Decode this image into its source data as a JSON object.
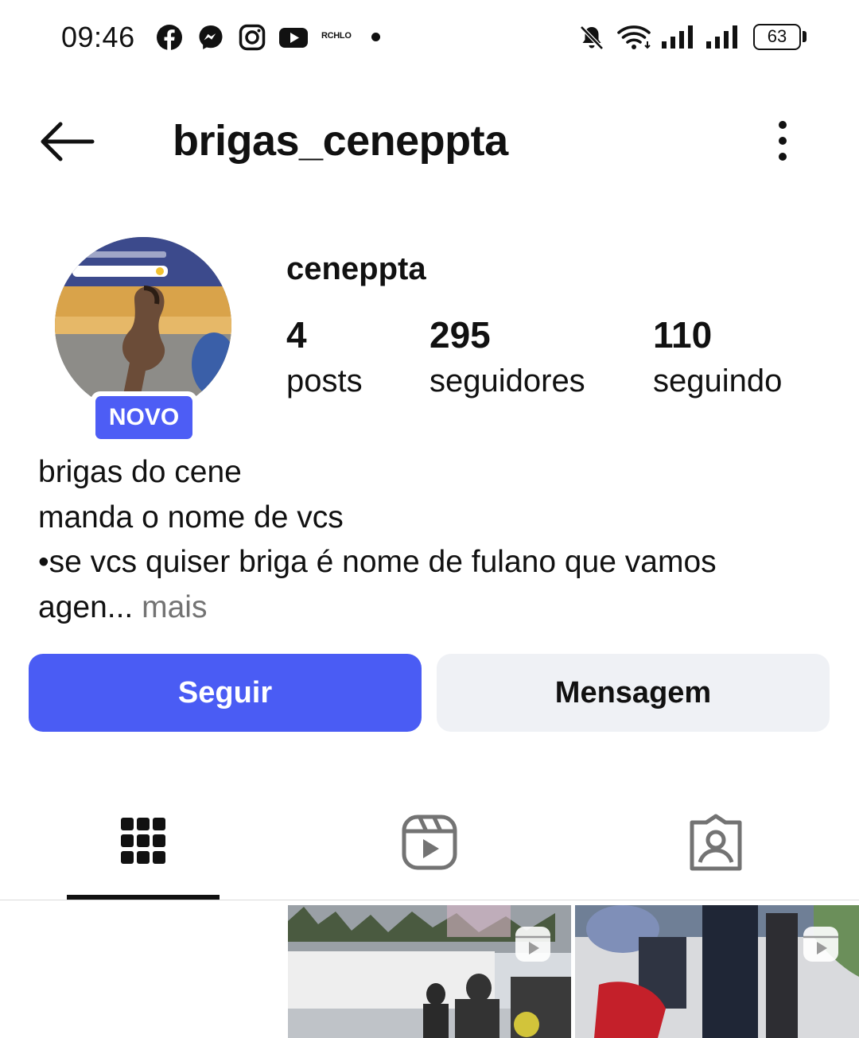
{
  "status_bar": {
    "time": "09:46",
    "carrier_logo_text": "RCHLO",
    "battery": "63",
    "icons": [
      "facebook-icon",
      "messenger-icon",
      "instagram-icon",
      "youtube-icon",
      "mute-icon",
      "wifi-icon",
      "signal-icon"
    ]
  },
  "header": {
    "title": "brigas_ceneppta",
    "back_icon": "arrow-left-icon",
    "more_icon": "more-vertical-icon"
  },
  "profile": {
    "name": "ceneppta",
    "badge": "NOVO",
    "stats": [
      {
        "value": "4",
        "label": "posts"
      },
      {
        "value": "295",
        "label": "seguidores"
      },
      {
        "value": "110",
        "label": "seguindo"
      }
    ],
    "bio_lines": [
      "brigas do cene",
      "manda o nome de vcs",
      "•se vcs quiser briga é nome de fulano que vamos"
    ],
    "bio_last": "agen...",
    "bio_more": " mais"
  },
  "actions": {
    "follow": "Seguir",
    "message": "Mensagem"
  },
  "tabs": [
    {
      "icon": "grid-icon",
      "active": true
    },
    {
      "icon": "reels-icon",
      "active": false
    },
    {
      "icon": "tagged-icon",
      "active": false
    }
  ],
  "colors": {
    "accent": "#4a5cf4",
    "badge": "#4d5df5",
    "secondary_button": "#eff1f5",
    "muted_text": "#737373"
  }
}
